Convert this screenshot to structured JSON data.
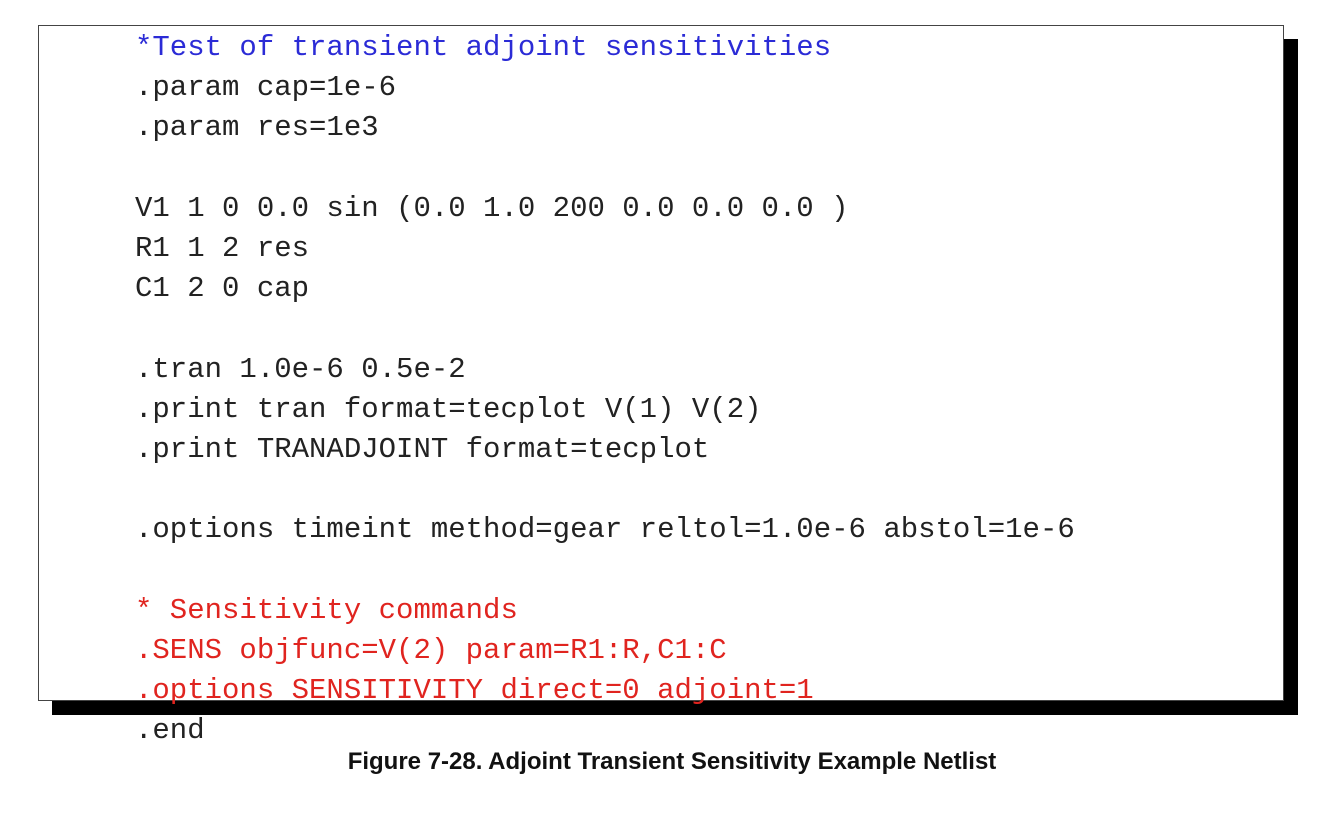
{
  "netlist": {
    "lines": [
      {
        "text": "*Test of transient adjoint sensitivities",
        "color": "blue"
      },
      {
        "text": ".param cap=1e-6",
        "color": "black"
      },
      {
        "text": ".param res=1e3",
        "color": "black"
      },
      {
        "text": "",
        "color": "black"
      },
      {
        "text": "V1 1 0 0.0 sin (0.0 1.0 200 0.0 0.0 0.0 )",
        "color": "black"
      },
      {
        "text": "R1 1 2 res",
        "color": "black"
      },
      {
        "text": "C1 2 0 cap",
        "color": "black"
      },
      {
        "text": "",
        "color": "black"
      },
      {
        "text": ".tran 1.0e-6 0.5e-2",
        "color": "black"
      },
      {
        "text": ".print tran format=tecplot V(1) V(2)",
        "color": "black"
      },
      {
        "text": ".print TRANADJOINT format=tecplot",
        "color": "black"
      },
      {
        "text": "",
        "color": "black"
      },
      {
        "text": ".options timeint method=gear reltol=1.0e-6 abstol=1e-6",
        "color": "black"
      },
      {
        "text": "",
        "color": "black"
      },
      {
        "text": "* Sensitivity commands",
        "color": "red"
      },
      {
        "text": ".SENS objfunc=V(2) param=R1:R,C1:C",
        "color": "red"
      },
      {
        "text": ".options SENSITIVITY direct=0 adjoint=1",
        "color": "red"
      },
      {
        "text": ".end",
        "color": "black"
      }
    ]
  },
  "caption": "Figure 7-28. Adjoint Transient Sensitivity Example Netlist",
  "colors": {
    "blue": "#2b2bd6",
    "red": "#e0241f",
    "black": "#222222"
  }
}
